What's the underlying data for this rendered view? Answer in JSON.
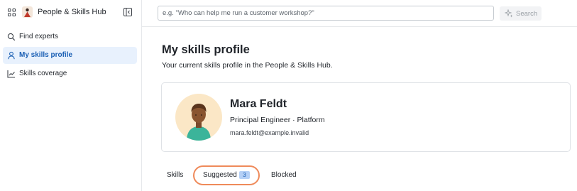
{
  "app": {
    "name": "People & Skills Hub"
  },
  "sidebar": {
    "items": [
      {
        "label": "Find experts",
        "icon": "search-icon",
        "active": false
      },
      {
        "label": "My skills profile",
        "icon": "user-icon",
        "active": true
      },
      {
        "label": "Skills coverage",
        "icon": "trend-chart-icon",
        "active": false
      }
    ]
  },
  "search": {
    "placeholder": "e.g. \"Who can help me run a customer workshop?\"",
    "value": "",
    "button_label": "Search",
    "button_icon": "sparkle-icon"
  },
  "page": {
    "title": "My skills profile",
    "subtitle": "Your current skills profile in the People & Skills Hub."
  },
  "profile": {
    "name": "Mara Feldt",
    "role": "Principal Engineer · Platform",
    "email": "mara.feldt@example.invalid"
  },
  "tabs": [
    {
      "label": "Skills"
    },
    {
      "label": "Suggested",
      "badge": "3"
    },
    {
      "label": "Blocked"
    }
  ],
  "colors": {
    "accent": "#1a5fb4",
    "active_nav_bg": "#e8f1fd",
    "highlight_ring": "#ef8a5a",
    "badge_bg": "#b5d0f6",
    "avatar_bg": "#fbe7c6"
  }
}
